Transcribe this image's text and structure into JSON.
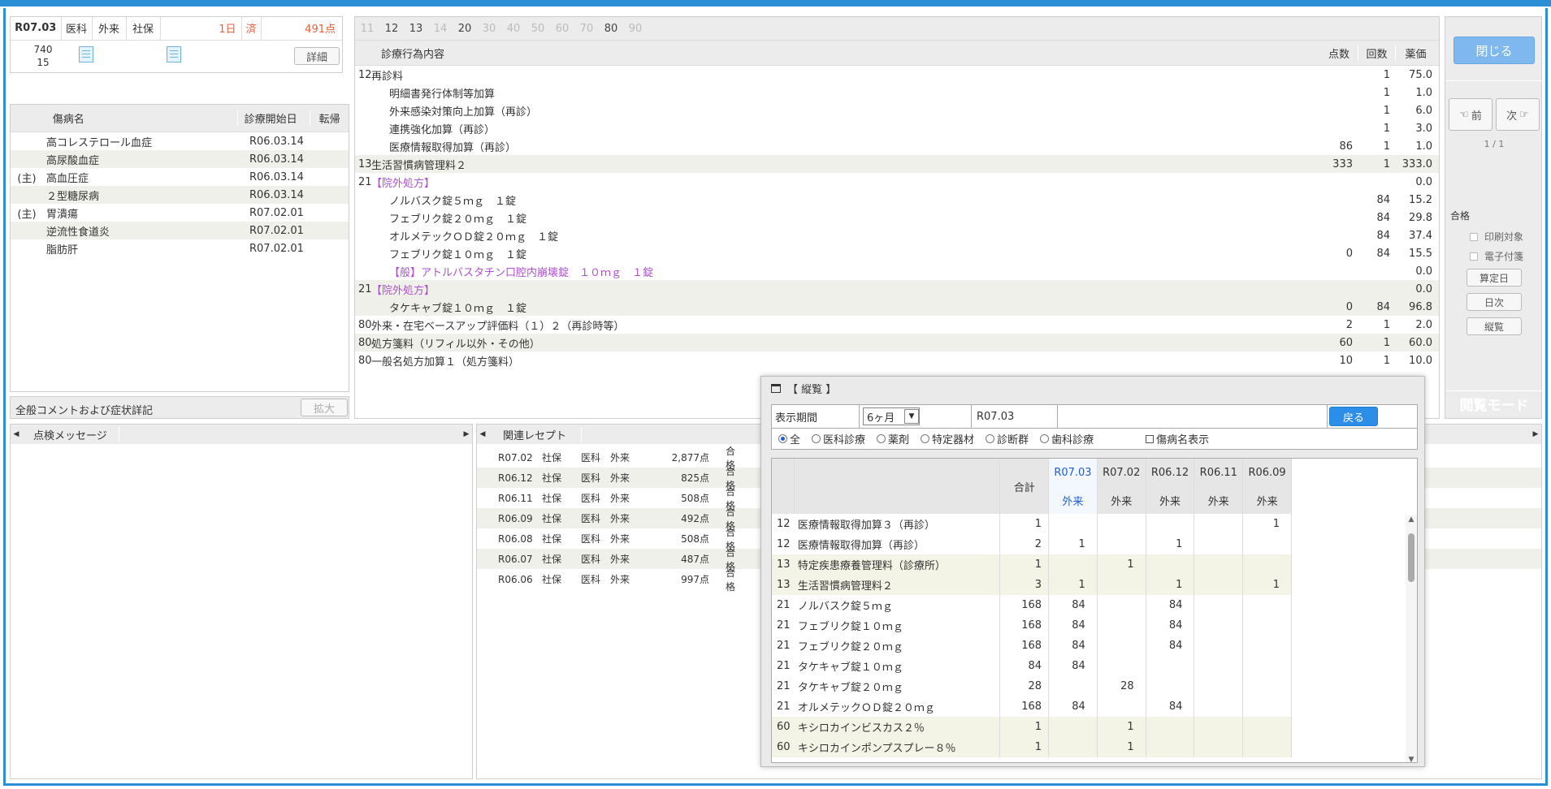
{
  "summary": {
    "ym": "R07.03",
    "ins": "医科",
    "visit": "外来",
    "kind": "社保",
    "days": "1日",
    "status": "済",
    "points": "491点",
    "n1": "740",
    "n2": "15",
    "detail_label": "詳細"
  },
  "disease": {
    "headers": [
      "傷病名",
      "診療開始日",
      "転帰"
    ],
    "rows": [
      {
        "prefix": "",
        "name": "高コレステロール血症",
        "date": "R06.03.14"
      },
      {
        "prefix": "",
        "name": "高尿酸血症",
        "date": "R06.03.14"
      },
      {
        "prefix": "(主)",
        "name": "高血圧症",
        "date": "R06.03.14"
      },
      {
        "prefix": "",
        "name": "２型糖尿病",
        "date": "R06.03.14"
      },
      {
        "prefix": "(主)",
        "name": "胃潰瘍",
        "date": "R07.02.01"
      },
      {
        "prefix": "",
        "name": "逆流性食道炎",
        "date": "R07.02.01"
      },
      {
        "prefix": "",
        "name": "脂肪肝",
        "date": "R07.02.01"
      }
    ]
  },
  "comment": {
    "label": "全般コメントおよび症状詳記",
    "expand": "拡大"
  },
  "check_message": {
    "label": "点検メッセージ"
  },
  "treatment": {
    "ticks": [
      {
        "t": "11",
        "on": false
      },
      {
        "t": "12",
        "on": true
      },
      {
        "t": "13",
        "on": true
      },
      {
        "t": "14",
        "on": false
      },
      {
        "t": "20",
        "on": true
      },
      {
        "t": "30",
        "on": false
      },
      {
        "t": "40",
        "on": false
      },
      {
        "t": "50",
        "on": false
      },
      {
        "t": "60",
        "on": false
      },
      {
        "t": "70",
        "on": false
      },
      {
        "t": "80",
        "on": true
      },
      {
        "t": "90",
        "on": false
      }
    ],
    "headers": [
      "診療行為内容",
      "点数",
      "回数",
      "薬価"
    ],
    "rows": [
      {
        "code": "12",
        "name": "再診料",
        "pts": "",
        "cnt": "1",
        "price": "75.0",
        "sub": false,
        "purple": false,
        "stripe": false
      },
      {
        "code": "",
        "name": "明細書発行体制等加算",
        "pts": "",
        "cnt": "1",
        "price": "1.0",
        "sub": true,
        "purple": false,
        "stripe": false
      },
      {
        "code": "",
        "name": "外来感染対策向上加算（再診）",
        "pts": "",
        "cnt": "1",
        "price": "6.0",
        "sub": true,
        "purple": false,
        "stripe": false
      },
      {
        "code": "",
        "name": "連携強化加算（再診）",
        "pts": "",
        "cnt": "1",
        "price": "3.0",
        "sub": true,
        "purple": false,
        "stripe": false
      },
      {
        "code": "",
        "name": "医療情報取得加算（再診）",
        "pts": "86",
        "cnt": "1",
        "price": "1.0",
        "sub": true,
        "purple": false,
        "stripe": false
      },
      {
        "code": "13",
        "name": "生活習慣病管理料２",
        "pts": "333",
        "cnt": "1",
        "price": "333.0",
        "sub": false,
        "purple": false,
        "stripe": true
      },
      {
        "code": "21",
        "name": "【院外処方】",
        "pts": "",
        "cnt": "",
        "price": "0.0",
        "sub": false,
        "purple": true,
        "stripe": false
      },
      {
        "code": "",
        "name": "ノルバスク錠５ｍｇ　１錠",
        "pts": "",
        "cnt": "84",
        "price": "15.2",
        "sub": true,
        "purple": false,
        "stripe": false
      },
      {
        "code": "",
        "name": "フェブリク錠２０ｍｇ　１錠",
        "pts": "",
        "cnt": "84",
        "price": "29.8",
        "sub": true,
        "purple": false,
        "stripe": false
      },
      {
        "code": "",
        "name": "オルメテックＯＤ錠２０ｍｇ　１錠",
        "pts": "",
        "cnt": "84",
        "price": "37.4",
        "sub": true,
        "purple": false,
        "stripe": false
      },
      {
        "code": "",
        "name": "フェブリク錠１０ｍｇ　１錠",
        "pts": "0",
        "cnt": "84",
        "price": "15.5",
        "sub": true,
        "purple": false,
        "stripe": false
      },
      {
        "code": "",
        "name": "【般】アトルバスタチン口腔内崩壊錠　１０ｍｇ　１錠",
        "pts": "",
        "cnt": "",
        "price": "0.0",
        "sub": true,
        "purple": true,
        "stripe": false
      },
      {
        "code": "21",
        "name": "【院外処方】",
        "pts": "",
        "cnt": "",
        "price": "0.0",
        "sub": false,
        "purple": true,
        "stripe": true
      },
      {
        "code": "",
        "name": "タケキャブ錠１０ｍｇ　１錠",
        "pts": "0",
        "cnt": "84",
        "price": "96.8",
        "sub": true,
        "purple": false,
        "stripe": true
      },
      {
        "code": "80",
        "name": "外来・在宅ベースアップ評価料（１）２（再診時等）",
        "pts": "2",
        "cnt": "1",
        "price": "2.0",
        "sub": false,
        "purple": false,
        "stripe": false
      },
      {
        "code": "80",
        "name": "処方箋料（リフィル以外・その他）",
        "pts": "60",
        "cnt": "1",
        "price": "60.0",
        "sub": false,
        "purple": false,
        "stripe": true
      },
      {
        "code": "80",
        "name": "一般名処方加算１（処方箋料）",
        "pts": "10",
        "cnt": "1",
        "price": "10.0",
        "sub": false,
        "purple": false,
        "stripe": false
      }
    ]
  },
  "related": {
    "label": "関連レセプト",
    "rows": [
      {
        "ym": "R07.02",
        "kind": "社保",
        "ins": "医科",
        "visit": "外来",
        "pts": "2,877点",
        "result": "合格"
      },
      {
        "ym": "R06.12",
        "kind": "社保",
        "ins": "医科",
        "visit": "外来",
        "pts": "825点",
        "result": "合格"
      },
      {
        "ym": "R06.11",
        "kind": "社保",
        "ins": "医科",
        "visit": "外来",
        "pts": "508点",
        "result": "合格"
      },
      {
        "ym": "R06.09",
        "kind": "社保",
        "ins": "医科",
        "visit": "外来",
        "pts": "492点",
        "result": "合格"
      },
      {
        "ym": "R06.08",
        "kind": "社保",
        "ins": "医科",
        "visit": "外来",
        "pts": "508点",
        "result": "合格"
      },
      {
        "ym": "R06.07",
        "kind": "社保",
        "ins": "医科",
        "visit": "外来",
        "pts": "487点",
        "result": "合格"
      },
      {
        "ym": "R06.06",
        "kind": "社保",
        "ins": "医科",
        "visit": "外来",
        "pts": "997点",
        "result": "合格"
      }
    ]
  },
  "side": {
    "close": "閉じる",
    "prev": "前",
    "next": "次",
    "page": "1 / 1",
    "result": "合格",
    "print": "印刷対象",
    "eattach": "電子付箋",
    "calc": "算定日",
    "daily": "日次",
    "vertical": "縦覧",
    "mode": "閲覧モード"
  },
  "popup": {
    "title": "【 縦覧 】",
    "period_label": "表示期間",
    "period_value": "6ヶ月",
    "ym": "R07.03",
    "back": "戻る",
    "radios": [
      {
        "label": "全",
        "on": true
      },
      {
        "label": "医科診療",
        "on": false
      },
      {
        "label": "薬剤",
        "on": false
      },
      {
        "label": "特定器材",
        "on": false
      },
      {
        "label": "診断群",
        "on": false
      },
      {
        "label": "歯科診療",
        "on": false
      }
    ],
    "disease_toggle": "傷病名表示",
    "total_label": "合計",
    "months": [
      {
        "ym": "R07.03",
        "visit": "外来",
        "current": true
      },
      {
        "ym": "R07.02",
        "visit": "外来",
        "current": false
      },
      {
        "ym": "R06.12",
        "visit": "外来",
        "current": false
      },
      {
        "ym": "R06.11",
        "visit": "外来",
        "current": false
      },
      {
        "ym": "R06.09",
        "visit": "外来",
        "current": false
      }
    ],
    "rows": [
      {
        "code": "12",
        "name": "医療情報取得加算３（再診）",
        "total": "1",
        "v": [
          "",
          "",
          "",
          "",
          "1"
        ],
        "stripe": false
      },
      {
        "code": "12",
        "name": "医療情報取得加算（再診）",
        "total": "2",
        "v": [
          "1",
          "",
          "1",
          "",
          ""
        ],
        "stripe": false
      },
      {
        "code": "13",
        "name": "特定疾患療養管理料（診療所）",
        "total": "1",
        "v": [
          "",
          "1",
          "",
          "",
          ""
        ],
        "stripe": true
      },
      {
        "code": "13",
        "name": "生活習慣病管理料２",
        "total": "3",
        "v": [
          "1",
          "",
          "1",
          "",
          "1"
        ],
        "stripe": true
      },
      {
        "code": "21",
        "name": "ノルバスク錠５ｍｇ",
        "total": "168",
        "v": [
          "84",
          "",
          "84",
          "",
          ""
        ],
        "stripe": false
      },
      {
        "code": "21",
        "name": "フェブリク錠１０ｍｇ",
        "total": "168",
        "v": [
          "84",
          "",
          "84",
          "",
          ""
        ],
        "stripe": false
      },
      {
        "code": "21",
        "name": "フェブリク錠２０ｍｇ",
        "total": "168",
        "v": [
          "84",
          "",
          "84",
          "",
          ""
        ],
        "stripe": false
      },
      {
        "code": "21",
        "name": "タケキャブ錠１０ｍｇ",
        "total": "84",
        "v": [
          "84",
          "",
          "",
          "",
          ""
        ],
        "stripe": false
      },
      {
        "code": "21",
        "name": "タケキャブ錠２０ｍｇ",
        "total": "28",
        "v": [
          "",
          "28",
          "",
          "",
          ""
        ],
        "stripe": false
      },
      {
        "code": "21",
        "name": "オルメテックＯＤ錠２０ｍｇ",
        "total": "168",
        "v": [
          "84",
          "",
          "84",
          "",
          ""
        ],
        "stripe": false
      },
      {
        "code": "60",
        "name": "キシロカインビスカス２％",
        "total": "1",
        "v": [
          "",
          "1",
          "",
          "",
          ""
        ],
        "stripe": true
      },
      {
        "code": "60",
        "name": "キシロカインポンプスプレー８％",
        "total": "1",
        "v": [
          "",
          "1",
          "",
          "",
          ""
        ],
        "stripe": true
      }
    ]
  }
}
